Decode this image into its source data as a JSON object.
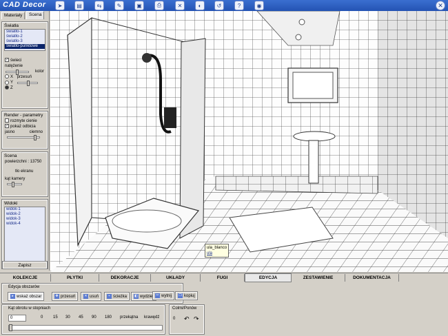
{
  "app": {
    "title": "CAD Decor"
  },
  "toolbar_icons": [
    "pointer-icon",
    "export-icon",
    "transfer-icon",
    "edit-icon",
    "save-icon",
    "print-icon",
    "delete-icon",
    "light-icon",
    "undo-icon",
    "help-icon",
    "globe-icon"
  ],
  "left_panel": {
    "tabs": [
      "Materiały",
      "Scena"
    ],
    "lights": {
      "title": "Światła",
      "items": [
        "światło-1",
        "światło-2",
        "światło-3",
        "światło-punktowe"
      ],
      "selected_index": 3,
      "shine_label": "świeci",
      "intensity_label": "natężenie",
      "color_label": "kolor",
      "axis_x": "X",
      "axis_y": "Y",
      "axis_z": "Z",
      "move_label": "przesuń"
    },
    "render": {
      "title": "Render - parametry",
      "soft_shadows": "rozmyte cienie",
      "show_reflections": "pokaż odbicia",
      "bright_label": "jasno",
      "dark_label": "ciemno"
    },
    "scene": {
      "title": "Scena",
      "surfaces": "powierzchni : 13750",
      "screen_bg": "tło ekranu",
      "camera_angle": "kąt kamery"
    },
    "views": {
      "title": "Widoki",
      "items": [
        "widok-1",
        "widok-2",
        "widok-3",
        "widok-4"
      ]
    },
    "save_button": "Zapisz"
  },
  "viewport": {
    "tooltip": {
      "line1": "ula_blanco",
      "line2": "ula"
    }
  },
  "main_tabs": {
    "items": [
      "KOLEKCJE",
      "PŁYTKI",
      "DEKORACJE",
      "UKŁADY",
      "FUGI",
      "EDYCJA",
      "ZESTAWIENIE",
      "DOKUMENTACJA"
    ],
    "active_index": 5
  },
  "edit_panel": {
    "areas_title": "Edycja obszarów",
    "buttons": [
      "wskaż obszar",
      "przesuń",
      "usuń",
      "ścieżka",
      "wydziel",
      "wytnij",
      "kopiuj"
    ],
    "rotation_title": "Kąt obrotu w stopniach",
    "rotation_value": "0",
    "rotation_presets": [
      "0",
      "15",
      "30",
      "45",
      "90",
      "180"
    ],
    "diagonal": "przekątna",
    "edge": "krawędź",
    "joint_title": "Colmi/Ponów",
    "joint_value": "0"
  },
  "colors": {
    "titlebar": "#2453b3",
    "panel": "#d4d0c8",
    "selection": "#0a246a"
  }
}
